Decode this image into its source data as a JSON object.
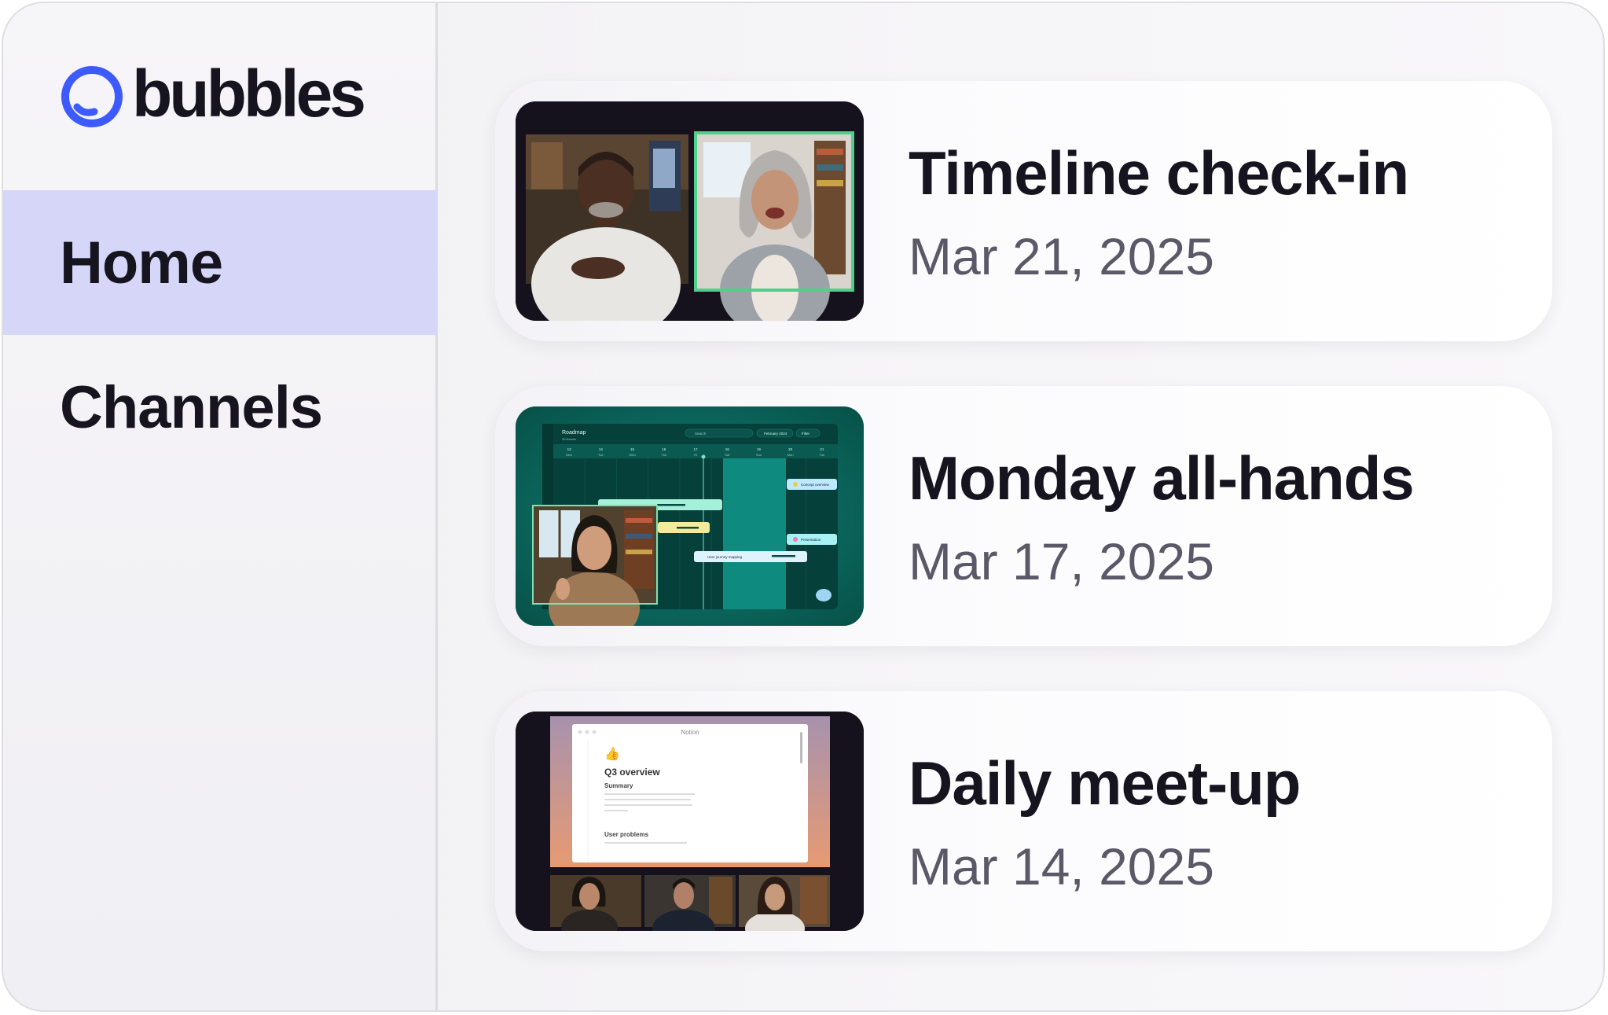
{
  "app": {
    "logo_text": "bubbles",
    "brand_color": "#3d5afe"
  },
  "sidebar": {
    "items": [
      {
        "label": "Home",
        "active": true
      },
      {
        "label": "Channels",
        "active": false
      }
    ]
  },
  "meetings": [
    {
      "title": "Timeline check-in",
      "date": "Mar 21, 2025",
      "thumbnail": "two-person-video-call"
    },
    {
      "title": "Monday all-hands",
      "date": "Mar 17, 2025",
      "thumbnail": "roadmap-screen-share",
      "screen": {
        "app_title": "Roadmap",
        "subtitle": "20 Events",
        "search": "Search",
        "date_range": "February 2024",
        "filter": "Filter",
        "days": [
          "Mon",
          "Tue",
          "Wed",
          "Thu",
          "Fri",
          "Sat",
          "Sun",
          "Mon",
          "Tue"
        ],
        "day_numbers": [
          "13",
          "14",
          "15",
          "16",
          "17",
          "18",
          "19",
          "20",
          "21"
        ],
        "events": [
          "Concept overview",
          "Presentation",
          "User journey mapping"
        ]
      }
    },
    {
      "title": "Daily meet-up",
      "date": "Mar 14, 2025",
      "thumbnail": "notion-screen-share",
      "screen": {
        "window_title": "Notion",
        "doc_title": "Q3 overview",
        "section1": "Summary",
        "section2": "User problems",
        "emoji": "👍"
      }
    }
  ]
}
